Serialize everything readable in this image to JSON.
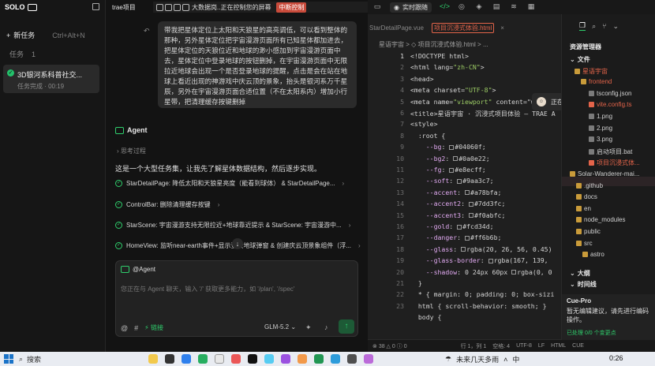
{
  "app": {
    "logo": "SOLO",
    "project": "trae项目"
  },
  "share_bar": {
    "text": "大数据岗..正在控制您的屏幕",
    "stop_label": "中断控制"
  },
  "left": {
    "new_task": "新任务",
    "new_task_shortcut": "Ctrl+Alt+N",
    "tasks_label": "任务",
    "tasks_count": "1",
    "task_title": "3D银河系科普社交...",
    "task_status": "任务完成 · 00:19"
  },
  "chat": {
    "user_message": "带我把星体定位上太阳和天狼星的高亮调低，可以看到整体的那种，另外星体定位把宇宙漫游页面所有已知星体都加进去，把星体定位的天狼位近和地球的渺小感加到宇宙漫游页面中去，星体定位中登录地球的按钮删掉，在宇宙漫游页面中无限拉近地球会出现一个是否登录地球的提醒，点击是会在站在地球上看近出现的神游戏中庆云顶的景象，抬头是银河系万千星辰，另外在宇宙漫游页面合适位置（不在太阳系内）增加小行星带，把清理缓存按键删掉",
    "agent_name": "Agent",
    "thinking": "思考过程",
    "summary": "这是一个大型任务集，让我先了解星体数据结构，然后逐步实现。",
    "steps": [
      "StarDetailPage: 降低太阳和天狼星亮度（能看到球体） & StarDetailPage...",
      "ControlBar: 删除清理缓存按键",
      "StarScene: 宇宙漫游支持无限拉近+地球靠近提示 & StarScene: 宇宙漫游中...",
      "HomeView: 监听near-earth事件+显示登录地球弹窗 & 创建庆云顶景象组件（浮..."
    ]
  },
  "input": {
    "agent_tag": "@Agent",
    "placeholder": "您正在与 Agent 聊天，输入 '/' 获取更多能力，如 '/plan', '/spec'",
    "link": "链接",
    "model": "GLM-5.2"
  },
  "editor": {
    "realtime_label": "实时跟随",
    "tabs": [
      "StarDetailPage.vue",
      "项目沉浸式体验.html"
    ],
    "breadcrumb": "星语宇宙 > ◇ 项目沉浸式体验.html > ...",
    "lines": [
      "1",
      "2",
      "3",
      "4",
      "5",
      "6",
      "7",
      "8",
      "9",
      "10",
      "11",
      "12",
      "13",
      "14",
      "15",
      "16",
      "17",
      "18",
      "19",
      "20",
      "21",
      "22",
      "23"
    ],
    "code": [
      "<!DOCTYPE html>",
      "<html lang=\"zh-CN\">",
      "<head>",
      "<meta charset=\"UTF-8\">",
      "<meta name=\"viewport\" content=\"w",
      "<title>星语宇宙 · 沉浸式项目体验 — TRAE A",
      "<style>",
      "  :root {",
      "    --bg: #04060f;",
      "    --bg2: #0a0e22;",
      "    --fg: #e8ecff;",
      "    --soft: #9aa3c7;",
      "    --accent: #a78bfa;",
      "    --accent2: #7dd3fc;",
      "    --accent3: #f0abfc;",
      "    --gold: #fcd34d;",
      "    --danger: #ff6b6b;",
      "    --glass: rgba(20, 26, 56, 0.45)",
      "    --glass-border: rgba(167, 139,",
      "    --shadow: 0 24px 60px rgba(0, 0",
      "  }",
      "  * { margin: 0; padding: 0; box-sizi",
      "  html { scroll-behavior: smooth; }",
      "  body {"
    ],
    "speaking": "正在讲话:",
    "status": [
      "38",
      "0",
      "0",
      "行 1，列 1",
      "空格: 4",
      "UTF-8",
      "LF",
      "HTML",
      "CUE"
    ]
  },
  "explorer": {
    "title": "资源管理器",
    "items": [
      {
        "label": "文件",
        "kind": "section"
      },
      {
        "label": "星语宇宙",
        "kind": "folder-red"
      },
      {
        "label": "frontend",
        "kind": "folder-red"
      },
      {
        "label": "tsconfig.json",
        "kind": "file"
      },
      {
        "label": "vite.config.ts",
        "kind": "file-red"
      },
      {
        "label": "1.png",
        "kind": "file"
      },
      {
        "label": "2.png",
        "kind": "file"
      },
      {
        "label": "3.png",
        "kind": "file"
      },
      {
        "label": "启动项目.bat",
        "kind": "file"
      },
      {
        "label": "项目沉浸式体...",
        "kind": "file-red"
      },
      {
        "label": "Solar-Wanderer-mai...",
        "kind": "folder"
      },
      {
        "label": ".github",
        "kind": "folder"
      },
      {
        "label": "docs",
        "kind": "folder"
      },
      {
        "label": "en",
        "kind": "folder"
      },
      {
        "label": "node_modules",
        "kind": "folder"
      },
      {
        "label": "public",
        "kind": "folder"
      },
      {
        "label": "src",
        "kind": "folder"
      },
      {
        "label": "astro",
        "kind": "folder"
      },
      {
        "label": "大纲",
        "kind": "section"
      },
      {
        "label": "时间线",
        "kind": "section"
      }
    ],
    "cue_title": "Cue-Pro",
    "cue_text": "暂无编辑建议，请先进行编码操作。",
    "cue_done": "已处理 0/0 个变更点"
  },
  "taskbar": {
    "search": "搜索",
    "weather": "未来几天多雨",
    "input_lang": "中",
    "time": "0:26"
  }
}
